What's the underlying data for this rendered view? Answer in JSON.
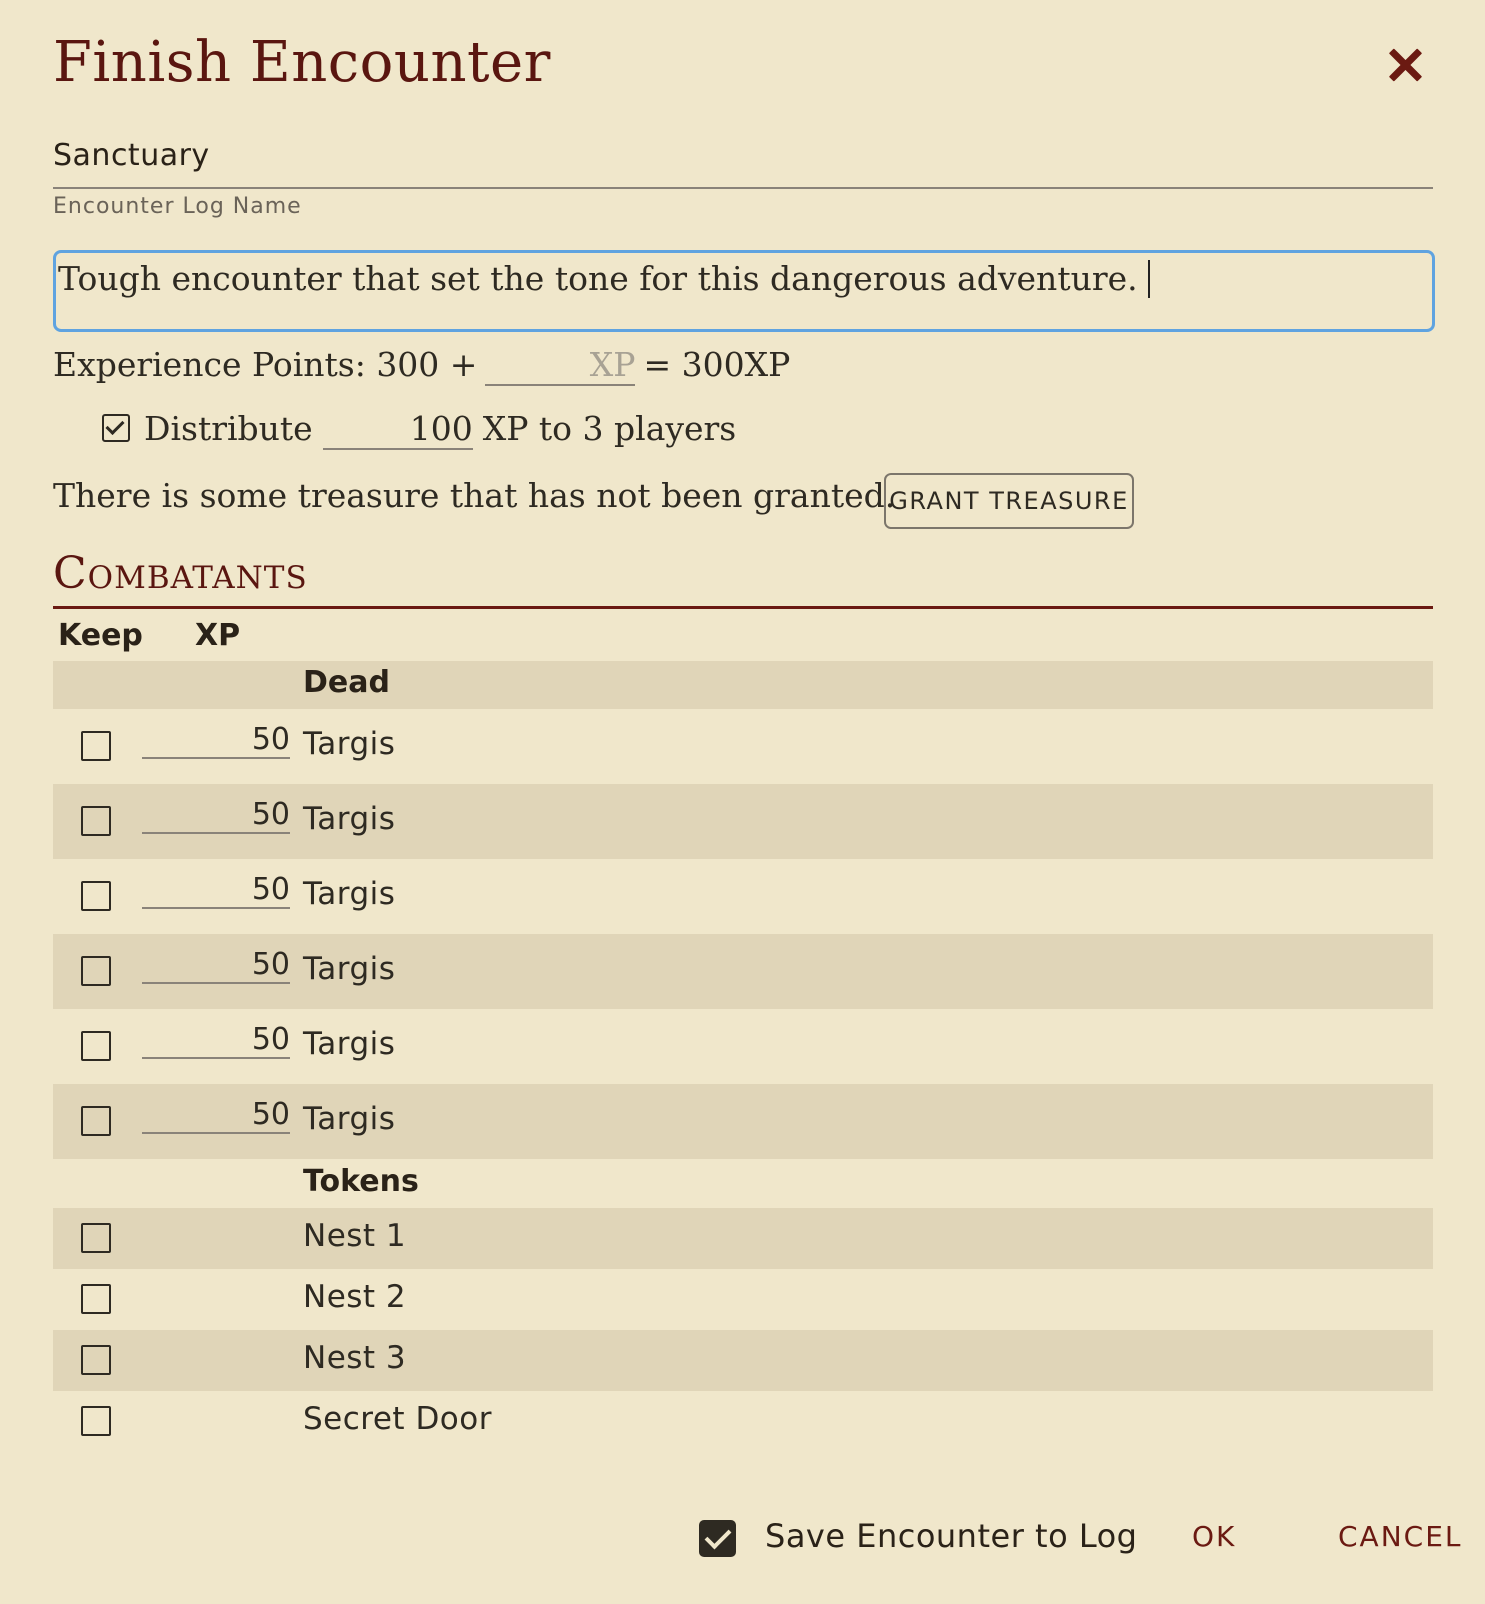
{
  "dialog": {
    "title": "Finish Encounter",
    "log_name_value": "Sanctuary",
    "log_name_label": "Encounter Log Name",
    "notes_value": "Tough encounter that set the tone for this dangerous adventure."
  },
  "xp": {
    "prefix": "Experience Points: 300 +",
    "input_placeholder": "XP",
    "suffix": "= 300XP",
    "distribute_checked": true,
    "distribute_label": "Distribute",
    "distribute_value": "100",
    "distribute_suffix": "XP to 3 players"
  },
  "treasure": {
    "message": "There is some treasure that has not been granted.",
    "button_label": "GRANT TREASURE"
  },
  "combatants": {
    "section_title": "Combatants",
    "col_keep": "Keep",
    "col_xp": "XP",
    "groups": [
      {
        "label": "Dead",
        "rows": [
          {
            "xp": "50",
            "name": "Targis"
          },
          {
            "xp": "50",
            "name": "Targis"
          },
          {
            "xp": "50",
            "name": "Targis"
          },
          {
            "xp": "50",
            "name": "Targis"
          },
          {
            "xp": "50",
            "name": "Targis"
          },
          {
            "xp": "50",
            "name": "Targis"
          }
        ]
      },
      {
        "label": "Tokens",
        "rows": [
          {
            "name": "Nest 1"
          },
          {
            "name": "Nest 2"
          },
          {
            "name": "Nest 3"
          },
          {
            "name": "Secret Door"
          }
        ]
      }
    ]
  },
  "footer": {
    "save_to_log_checked": true,
    "save_to_log_label": "Save Encounter to Log",
    "ok_label": "OK",
    "cancel_label": "CANCEL"
  }
}
